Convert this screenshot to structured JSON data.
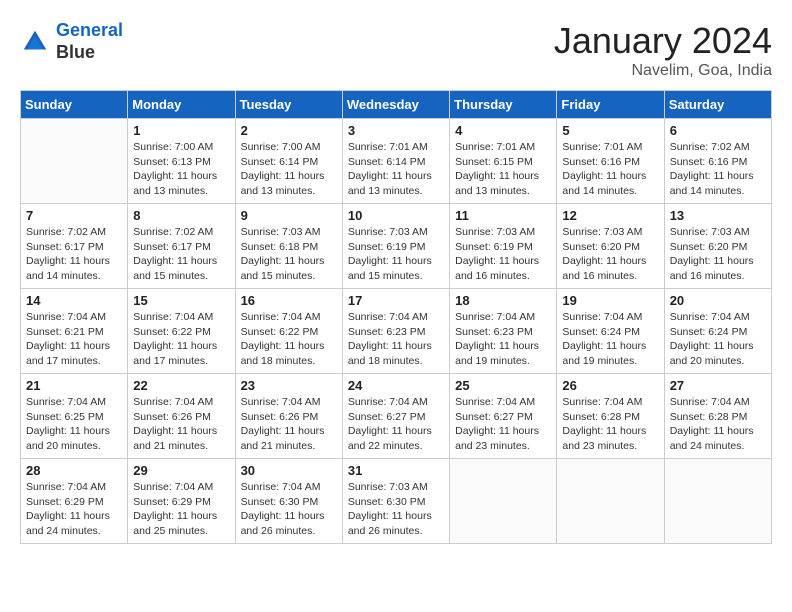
{
  "header": {
    "logo_line1": "General",
    "logo_line2": "Blue",
    "month_year": "January 2024",
    "location": "Navelim, Goa, India"
  },
  "weekdays": [
    "Sunday",
    "Monday",
    "Tuesday",
    "Wednesday",
    "Thursday",
    "Friday",
    "Saturday"
  ],
  "weeks": [
    [
      {
        "day": "",
        "info": ""
      },
      {
        "day": "1",
        "info": "Sunrise: 7:00 AM\nSunset: 6:13 PM\nDaylight: 11 hours\nand 13 minutes."
      },
      {
        "day": "2",
        "info": "Sunrise: 7:00 AM\nSunset: 6:14 PM\nDaylight: 11 hours\nand 13 minutes."
      },
      {
        "day": "3",
        "info": "Sunrise: 7:01 AM\nSunset: 6:14 PM\nDaylight: 11 hours\nand 13 minutes."
      },
      {
        "day": "4",
        "info": "Sunrise: 7:01 AM\nSunset: 6:15 PM\nDaylight: 11 hours\nand 13 minutes."
      },
      {
        "day": "5",
        "info": "Sunrise: 7:01 AM\nSunset: 6:16 PM\nDaylight: 11 hours\nand 14 minutes."
      },
      {
        "day": "6",
        "info": "Sunrise: 7:02 AM\nSunset: 6:16 PM\nDaylight: 11 hours\nand 14 minutes."
      }
    ],
    [
      {
        "day": "7",
        "info": "Sunrise: 7:02 AM\nSunset: 6:17 PM\nDaylight: 11 hours\nand 14 minutes."
      },
      {
        "day": "8",
        "info": "Sunrise: 7:02 AM\nSunset: 6:17 PM\nDaylight: 11 hours\nand 15 minutes."
      },
      {
        "day": "9",
        "info": "Sunrise: 7:03 AM\nSunset: 6:18 PM\nDaylight: 11 hours\nand 15 minutes."
      },
      {
        "day": "10",
        "info": "Sunrise: 7:03 AM\nSunset: 6:19 PM\nDaylight: 11 hours\nand 15 minutes."
      },
      {
        "day": "11",
        "info": "Sunrise: 7:03 AM\nSunset: 6:19 PM\nDaylight: 11 hours\nand 16 minutes."
      },
      {
        "day": "12",
        "info": "Sunrise: 7:03 AM\nSunset: 6:20 PM\nDaylight: 11 hours\nand 16 minutes."
      },
      {
        "day": "13",
        "info": "Sunrise: 7:03 AM\nSunset: 6:20 PM\nDaylight: 11 hours\nand 16 minutes."
      }
    ],
    [
      {
        "day": "14",
        "info": "Sunrise: 7:04 AM\nSunset: 6:21 PM\nDaylight: 11 hours\nand 17 minutes."
      },
      {
        "day": "15",
        "info": "Sunrise: 7:04 AM\nSunset: 6:22 PM\nDaylight: 11 hours\nand 17 minutes."
      },
      {
        "day": "16",
        "info": "Sunrise: 7:04 AM\nSunset: 6:22 PM\nDaylight: 11 hours\nand 18 minutes."
      },
      {
        "day": "17",
        "info": "Sunrise: 7:04 AM\nSunset: 6:23 PM\nDaylight: 11 hours\nand 18 minutes."
      },
      {
        "day": "18",
        "info": "Sunrise: 7:04 AM\nSunset: 6:23 PM\nDaylight: 11 hours\nand 19 minutes."
      },
      {
        "day": "19",
        "info": "Sunrise: 7:04 AM\nSunset: 6:24 PM\nDaylight: 11 hours\nand 19 minutes."
      },
      {
        "day": "20",
        "info": "Sunrise: 7:04 AM\nSunset: 6:24 PM\nDaylight: 11 hours\nand 20 minutes."
      }
    ],
    [
      {
        "day": "21",
        "info": "Sunrise: 7:04 AM\nSunset: 6:25 PM\nDaylight: 11 hours\nand 20 minutes."
      },
      {
        "day": "22",
        "info": "Sunrise: 7:04 AM\nSunset: 6:26 PM\nDaylight: 11 hours\nand 21 minutes."
      },
      {
        "day": "23",
        "info": "Sunrise: 7:04 AM\nSunset: 6:26 PM\nDaylight: 11 hours\nand 21 minutes."
      },
      {
        "day": "24",
        "info": "Sunrise: 7:04 AM\nSunset: 6:27 PM\nDaylight: 11 hours\nand 22 minutes."
      },
      {
        "day": "25",
        "info": "Sunrise: 7:04 AM\nSunset: 6:27 PM\nDaylight: 11 hours\nand 23 minutes."
      },
      {
        "day": "26",
        "info": "Sunrise: 7:04 AM\nSunset: 6:28 PM\nDaylight: 11 hours\nand 23 minutes."
      },
      {
        "day": "27",
        "info": "Sunrise: 7:04 AM\nSunset: 6:28 PM\nDaylight: 11 hours\nand 24 minutes."
      }
    ],
    [
      {
        "day": "28",
        "info": "Sunrise: 7:04 AM\nSunset: 6:29 PM\nDaylight: 11 hours\nand 24 minutes."
      },
      {
        "day": "29",
        "info": "Sunrise: 7:04 AM\nSunset: 6:29 PM\nDaylight: 11 hours\nand 25 minutes."
      },
      {
        "day": "30",
        "info": "Sunrise: 7:04 AM\nSunset: 6:30 PM\nDaylight: 11 hours\nand 26 minutes."
      },
      {
        "day": "31",
        "info": "Sunrise: 7:03 AM\nSunset: 6:30 PM\nDaylight: 11 hours\nand 26 minutes."
      },
      {
        "day": "",
        "info": ""
      },
      {
        "day": "",
        "info": ""
      },
      {
        "day": "",
        "info": ""
      }
    ]
  ]
}
